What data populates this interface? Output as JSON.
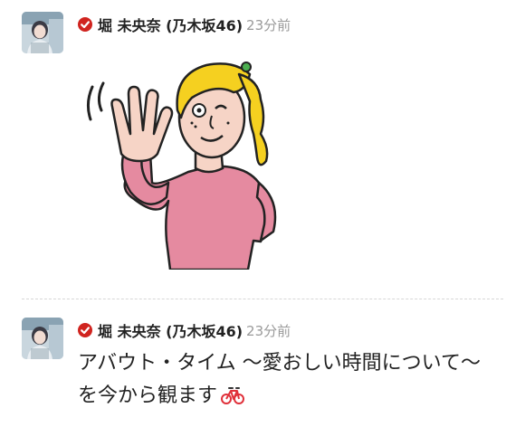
{
  "posts": [
    {
      "author": "堀 未央奈 (乃木坂46)",
      "time": "23分前",
      "type": "sticker",
      "sticker_icon": "waving-woman-sticker"
    },
    {
      "author": "堀 未央奈 (乃木坂46)",
      "time": "23分前",
      "type": "text",
      "text": "アバウト・タイム 〜愛おしい時間について〜 を今から観ます",
      "emoji_icon": "bicycle-icon"
    }
  ],
  "colors": {
    "verified": "#d0241f",
    "timestamp": "#9a9a9a",
    "text": "#222222",
    "shirt": "#e58aa0",
    "hair": "#f5d020"
  }
}
